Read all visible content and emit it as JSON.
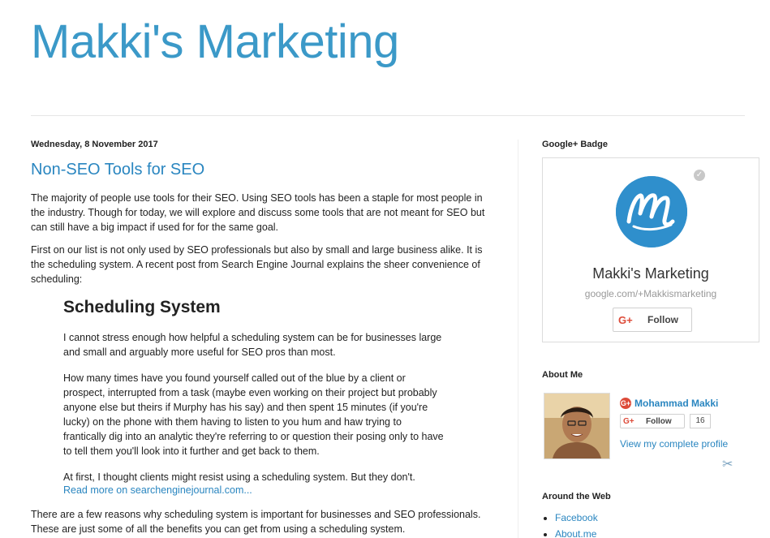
{
  "header": {
    "blog_title": "Makki's Marketing"
  },
  "post": {
    "date": "Wednesday, 8 November 2017",
    "title": "Non-SEO Tools for SEO",
    "paragraphs": [
      "The majority of people use tools for their SEO. Using SEO tools has been a staple for most people in the industry. Though for today, we will explore and discuss some tools that are not meant for SEO but can still have a big impact if used for for the same goal.",
      "First on our list is not only used by SEO professionals but also by small and large business alike. It is the scheduling system. A recent post from Search Engine Journal explains the sheer convenience of scheduling:"
    ],
    "quote": {
      "heading": "Scheduling System",
      "paragraphs": [
        "I cannot stress enough how helpful a scheduling system can be for businesses large and small and arguably more useful for SEO pros than most.",
        "How many times have you found yourself called out of the blue by a client or prospect, interrupted from a task (maybe even working on their project but probably anyone else but theirs if Murphy has his say) and then spent 15 minutes (if you're lucky) on the phone with them having to listen to you hum and haw trying to frantically dig into an analytic they're referring to or question their posing only to have to tell them you'll look into it further and get back to them.",
        "At first, I thought clients might resist using a scheduling system. But they don't."
      ],
      "read_more": "Read more on searchenginejournal.com..."
    },
    "closing_paragraph": "There are a few reasons why scheduling system is important for businesses and SEO professionals. These are just some of all the benefits you can get from using a scheduling system."
  },
  "sidebar": {
    "gplus_badge": {
      "title": "Google+ Badge",
      "name": "Makki's Marketing",
      "url": "google.com/+Makkismarketing",
      "follow_label": "Follow",
      "g_label": "G+",
      "verified_icon": "✓"
    },
    "about": {
      "title": "About Me",
      "profile_name": "Mohammad Makki",
      "follow_label": "Follow",
      "g_label": "G+",
      "follower_count": "16",
      "view_profile": "View my complete profile",
      "gp_badge": "G+",
      "tools_icon": "✂"
    },
    "around_web": {
      "title": "Around the Web",
      "links": [
        "Facebook",
        "About.me"
      ]
    }
  },
  "colors": {
    "title_blue": "#3b99c8",
    "link_blue": "#2a86c0",
    "gplus_red": "#dd4b39"
  }
}
